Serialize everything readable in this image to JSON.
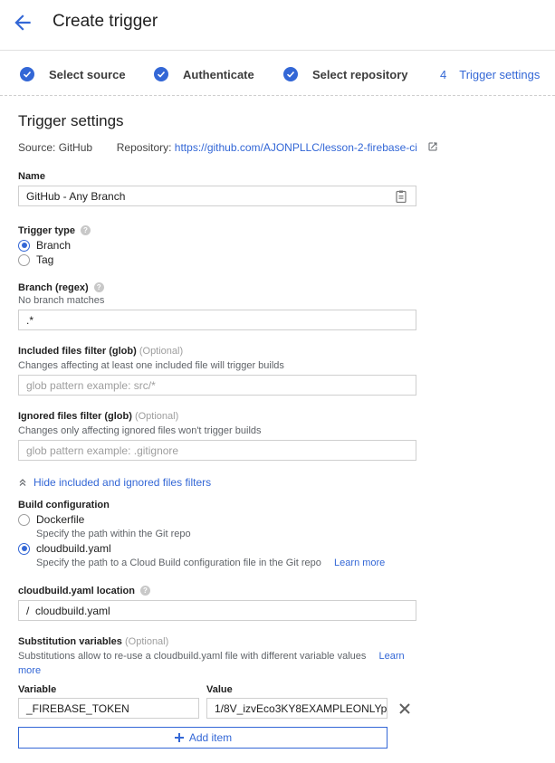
{
  "header": {
    "title": "Create trigger",
    "back_icon": "arrow-left-icon"
  },
  "stepper": {
    "steps": [
      {
        "label": "Select source",
        "state": "done"
      },
      {
        "label": "Authenticate",
        "state": "done"
      },
      {
        "label": "Select repository",
        "state": "done"
      },
      {
        "number": "4",
        "label": "Trigger settings",
        "state": "active"
      }
    ]
  },
  "section_title": "Trigger settings",
  "source": {
    "label": "Source:",
    "value": "GitHub",
    "repo_label": "Repository:",
    "repo_url": "https://github.com/AJONPLLC/lesson-2-firebase-ci"
  },
  "name": {
    "label": "Name",
    "value": "GitHub - Any Branch"
  },
  "trigger_type": {
    "label": "Trigger type",
    "options": [
      "Branch",
      "Tag"
    ],
    "selected": "Branch"
  },
  "branch": {
    "label": "Branch (regex)",
    "hint": "No branch matches",
    "value": ".*"
  },
  "included": {
    "label": "Included files filter (glob)",
    "optional": "(Optional)",
    "desc": "Changes affecting at least one included file will trigger builds",
    "placeholder": "glob pattern example: src/*"
  },
  "ignored": {
    "label": "Ignored files filter (glob)",
    "optional": "(Optional)",
    "desc": "Changes only affecting ignored files won't trigger builds",
    "placeholder": "glob pattern example: .gitignore"
  },
  "toggle_filters": "Hide included and ignored files filters",
  "build_config": {
    "label": "Build configuration",
    "dockerfile": {
      "label": "Dockerfile",
      "desc": "Specify the path within the Git repo"
    },
    "cloudbuild": {
      "label": "cloudbuild.yaml",
      "desc": "Specify the path to a Cloud Build configuration file in the Git repo",
      "learn_more": "Learn more"
    },
    "selected": "cloudbuild.yaml"
  },
  "cloudbuild_location": {
    "label": "cloudbuild.yaml location",
    "value": "/  cloudbuild.yaml"
  },
  "substitutions": {
    "label": "Substitution variables",
    "optional": "(Optional)",
    "desc": "Substitutions allow to re-use a cloudbuild.yaml file with different variable values",
    "learn_more_1": "Learn",
    "learn_more_2": "more",
    "variable_header": "Variable",
    "value_header": "Value",
    "rows": [
      {
        "variable": "_FIREBASE_TOKEN",
        "value": "1/8V_izvEco3KY8EXAMPLEONLYp"
      }
    ],
    "add_item": "Add item"
  }
}
